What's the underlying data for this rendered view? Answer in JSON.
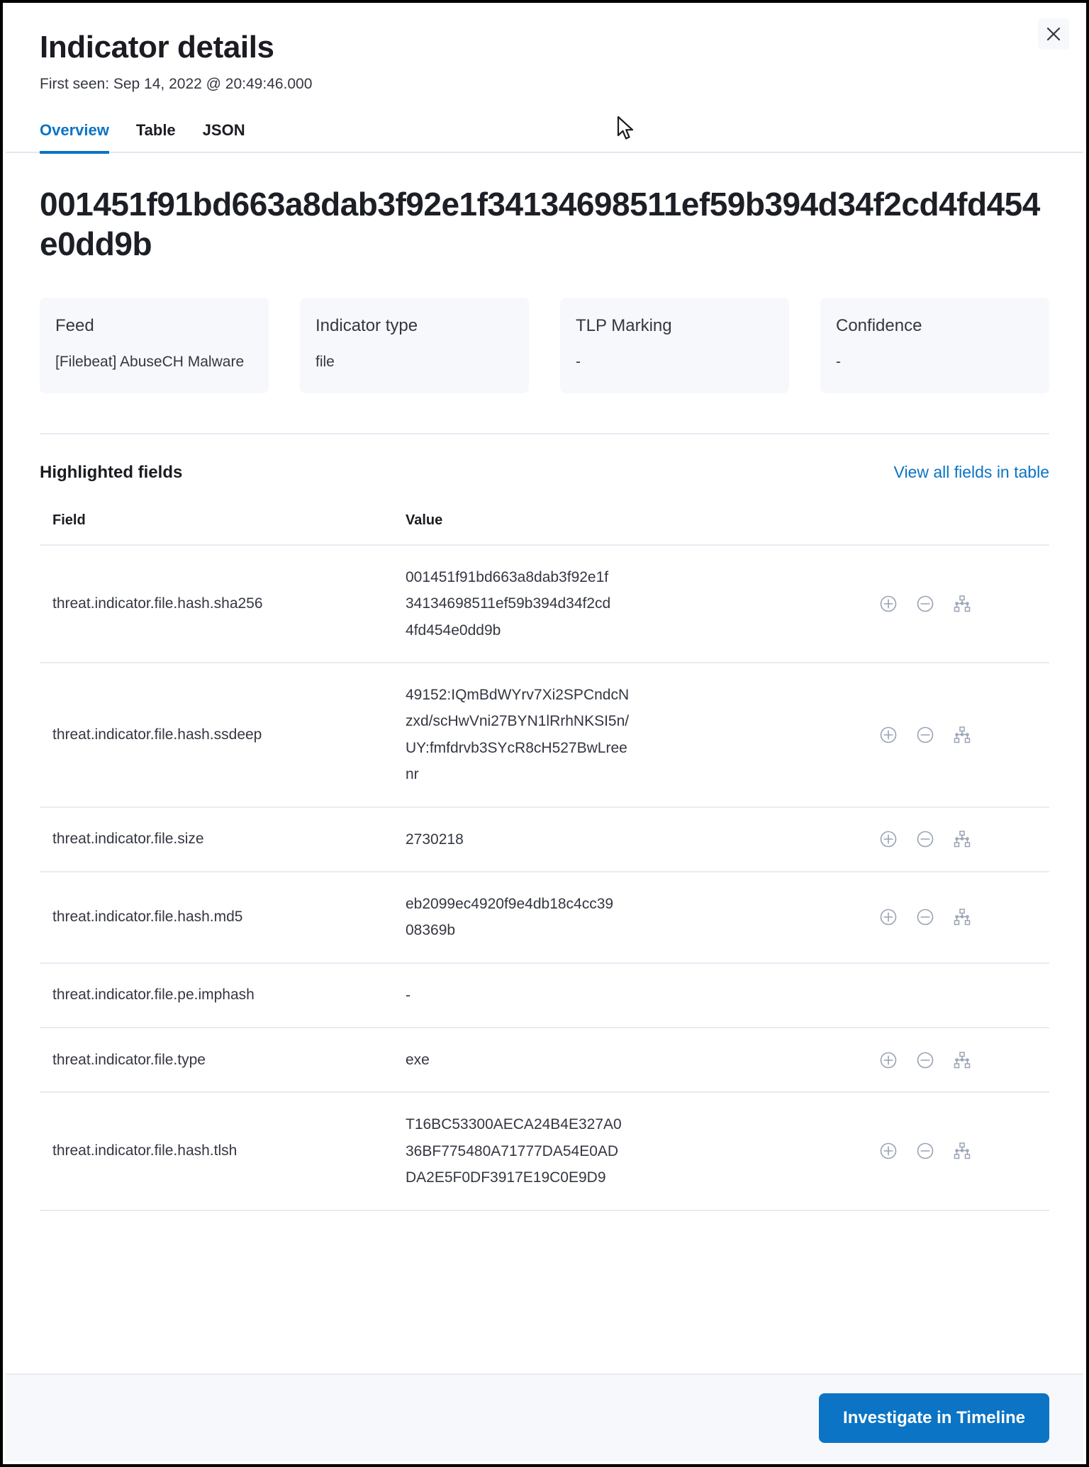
{
  "header": {
    "title": "Indicator details",
    "first_seen": "First seen: Sep 14, 2022 @ 20:49:46.000",
    "close_label": "close-icon",
    "tabs": [
      {
        "label": "Overview",
        "active": true
      },
      {
        "label": "Table",
        "active": false
      },
      {
        "label": "JSON",
        "active": false
      }
    ]
  },
  "main": {
    "indicator_hash": "001451f91bd663a8dab3f92e1f34134698511ef59b394d34f2cd4fd454e0dd9b",
    "cards": [
      {
        "label": "Feed",
        "value": "[Filebeat] AbuseCH Malware"
      },
      {
        "label": "Indicator type",
        "value": "file"
      },
      {
        "label": "TLP Marking",
        "value": "-"
      },
      {
        "label": "Confidence",
        "value": "-"
      }
    ],
    "highlighted": {
      "section_title": "Highlighted fields",
      "view_all_link": "View all fields in table",
      "columns": {
        "field": "Field",
        "value": "Value"
      },
      "rows": [
        {
          "field": "threat.indicator.file.hash.sha256",
          "value_lines": [
            "001451f91bd663a8dab3f92e1f",
            "34134698511ef59b394d34f2cd",
            "4fd454e0dd9b"
          ],
          "value": "001451f91bd663a8dab3f92e1f34134698511ef59b394d34f2cd4fd454e0dd9b",
          "has_actions": true
        },
        {
          "field": "threat.indicator.file.hash.ssdeep",
          "value_lines": [
            "49152:IQmBdWYrv7Xi2SPCndcN",
            "zxd/scHwVni27BYN1lRrhNKSI5n/",
            "UY:fmfdrvb3SYcR8cH527BwLree",
            "nr"
          ],
          "value": "49152:IQmBdWYrv7Xi2SPCndcNzxd/scHwVni27BYN1lRrhNKSI5n/UY:fmfdrvb3SYcR8cH527BwLreenr",
          "has_actions": true
        },
        {
          "field": "threat.indicator.file.size",
          "value_lines": [
            "2730218"
          ],
          "value": "2730218",
          "has_actions": true
        },
        {
          "field": "threat.indicator.file.hash.md5",
          "value_lines": [
            "eb2099ec4920f9e4db18c4cc39",
            "08369b"
          ],
          "value": "eb2099ec4920f9e4db18c4cc3908369b",
          "has_actions": true
        },
        {
          "field": "threat.indicator.file.pe.imphash",
          "value_lines": [
            "-"
          ],
          "value": "-",
          "has_actions": false
        },
        {
          "field": "threat.indicator.file.type",
          "value_lines": [
            "exe"
          ],
          "value": "exe",
          "has_actions": true
        },
        {
          "field": "threat.indicator.file.hash.tlsh",
          "value_lines": [
            "T16BC53300AECA24B4E327A0",
            "36BF775480A71777DA54E0AD",
            "DA2E5F0DF3917E19C0E9D9"
          ],
          "value": "T16BC53300AECA24B4E327A036BF775480A71777DA54E0ADDA2E5F0DF3917E19C0E9D9",
          "has_actions": true
        }
      ],
      "row_action_icons": [
        "filter-for-value-icon",
        "filter-out-value-icon",
        "toggle-column-in-table-icon"
      ]
    }
  },
  "footer": {
    "primary_action": "Investigate in Timeline"
  },
  "colors": {
    "accent": "#0b74c4",
    "text": "#343741",
    "heading": "#1a1c21",
    "card_bg": "#f7f8fc",
    "border": "#e9ebf3"
  }
}
